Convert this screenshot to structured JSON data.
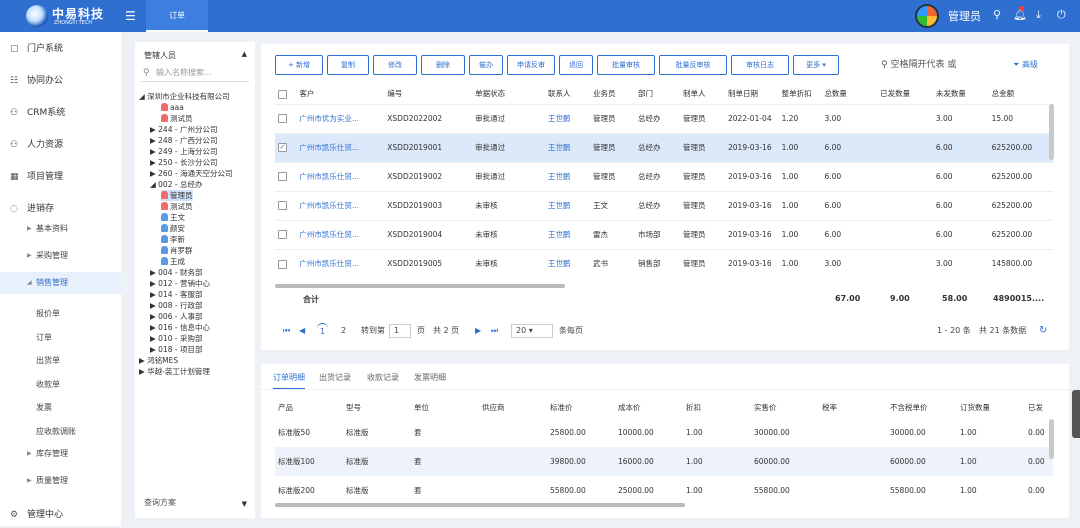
{
  "app": {
    "brand": "中易科技",
    "brand_sub": "ZHONGYI TECH",
    "top_tab": "订单",
    "user": "管理员"
  },
  "nav": {
    "items": [
      {
        "label": "门户系统",
        "icon": "portal-icon"
      },
      {
        "label": "协同办公",
        "icon": "office-icon"
      },
      {
        "label": "CRM系统",
        "icon": "crm-icon"
      },
      {
        "label": "人力资源",
        "icon": "hr-icon"
      },
      {
        "label": "项目管理",
        "icon": "project-icon"
      },
      {
        "label": "进销存",
        "icon": "inventory-icon"
      }
    ],
    "subs": [
      {
        "label": "基本资料"
      },
      {
        "label": "采购管理"
      },
      {
        "label": "销售管理"
      }
    ],
    "sales_leaves": [
      "报价单",
      "订单",
      "出货单",
      "收款单",
      "发票",
      "应收款调账"
    ],
    "subs2": [
      {
        "label": "库存管理"
      },
      {
        "label": "质量管理"
      }
    ],
    "bottom": {
      "label": "管理中心",
      "icon": "manage-icon"
    }
  },
  "tree": {
    "title": "管辖人员",
    "search_placeholder": "输入名称搜索...",
    "footer": "查询方案",
    "nodes": [
      {
        "t": "◢ 深圳市企业科技有限公司",
        "i": 0
      },
      {
        "t": "aaa",
        "i": 2,
        "p": "red"
      },
      {
        "t": "测试员",
        "i": 2,
        "p": "red"
      },
      {
        "t": "▶ 244 - 广州分公司",
        "i": 1
      },
      {
        "t": "▶ 248 - 广西分公司",
        "i": 1
      },
      {
        "t": "▶ 249 - 上海分公司",
        "i": 1
      },
      {
        "t": "▶ 250 - 长沙分公司",
        "i": 1
      },
      {
        "t": "▶ 260 - 海通天空分公司",
        "i": 1
      },
      {
        "t": "◢ 002 - 总经办",
        "i": 1
      },
      {
        "t": "管理员",
        "i": 2,
        "p": "red",
        "sel": true
      },
      {
        "t": "测试员",
        "i": 2,
        "p": "red"
      },
      {
        "t": "王文",
        "i": 2,
        "p": "blue"
      },
      {
        "t": "颜安",
        "i": 2,
        "p": "blue"
      },
      {
        "t": "李新",
        "i": 2,
        "p": "blue"
      },
      {
        "t": "肖罗群",
        "i": 2,
        "p": "blue"
      },
      {
        "t": "王成",
        "i": 2,
        "p": "blue"
      },
      {
        "t": "▶ 004 - 财务部",
        "i": 1
      },
      {
        "t": "▶ 012 - 营销中心",
        "i": 1
      },
      {
        "t": "▶ 014 - 客服部",
        "i": 1
      },
      {
        "t": "▶ 008 - 行政部",
        "i": 1
      },
      {
        "t": "▶ 006 - 人事部",
        "i": 1
      },
      {
        "t": "▶ 016 - 信息中心",
        "i": 1
      },
      {
        "t": "▶ 010 - 采购部",
        "i": 1
      },
      {
        "t": "▶ 018 - 项目部",
        "i": 1
      },
      {
        "t": "▶ 鸿铭MES",
        "i": 0
      },
      {
        "t": "▶ 华越-装工计划管理",
        "i": 0
      }
    ]
  },
  "toolbar": {
    "buttons": [
      "+ 新增",
      "复制",
      "修改",
      "删除",
      "催办",
      "申请反审",
      "退回",
      "批量审核",
      "批量反审核",
      "审核日志",
      "更多 ▾"
    ],
    "search_placeholder": "空格隔开代表 或",
    "advanced": "高级"
  },
  "orders": {
    "columns": [
      "客户",
      "编号",
      "单据状态",
      "联系人",
      "业务员",
      "部门",
      "制单人",
      "制单日期",
      "整单折扣",
      "总数量",
      "已发数量",
      "未发数量",
      "总金额"
    ],
    "rows": [
      {
        "checked": false,
        "cells": [
          "广州市优为实业...",
          "XSDD2022002",
          "审批通过",
          "王世鹏",
          "管理员",
          "总经办",
          "管理员",
          "2022-01-04",
          "1.20",
          "3.00",
          "",
          "3.00",
          "15.00"
        ]
      },
      {
        "checked": true,
        "cells": [
          "广州市凯乐仕贸...",
          "XSDD2019001",
          "审批通过",
          "王世鹏",
          "管理员",
          "总经办",
          "管理员",
          "2019-03-16",
          "1.00",
          "6.00",
          "",
          "6.00",
          "625200.00"
        ]
      },
      {
        "checked": false,
        "cells": [
          "广州市凯乐仕贸...",
          "XSDD2019002",
          "审批通过",
          "王世鹏",
          "管理员",
          "总经办",
          "管理员",
          "2019-03-16",
          "1.00",
          "6.00",
          "",
          "6.00",
          "625200.00"
        ]
      },
      {
        "checked": false,
        "cells": [
          "广州市凯乐仕贸...",
          "XSDD2019003",
          "未审核",
          "王世鹏",
          "王文",
          "总经办",
          "管理员",
          "2019-03-16",
          "1.00",
          "6.00",
          "",
          "6.00",
          "625200.00"
        ]
      },
      {
        "checked": false,
        "cells": [
          "广州市凯乐仕贸...",
          "XSDD2019004",
          "未审核",
          "王世鹏",
          "雷杰",
          "市场部",
          "管理员",
          "2019-03-16",
          "1.00",
          "6.00",
          "",
          "6.00",
          "625200.00"
        ]
      },
      {
        "checked": false,
        "cells": [
          "广州市凯乐仕贸...",
          "XSDD2019005",
          "未审核",
          "王世鹏",
          "武书",
          "销售部",
          "管理员",
          "2019-03-16",
          "1.00",
          "3.00",
          "",
          "3.00",
          "145800.00"
        ]
      }
    ],
    "summary": {
      "label": "合计",
      "total_qty": "67.00",
      "shipped": "9.00",
      "unshipped": "58.00",
      "amount": "4890015...."
    }
  },
  "pager": {
    "page1": "1",
    "page2": "2",
    "goto_label": "转到第",
    "goto_value": "1",
    "page_unit": "页",
    "total_pages": "共 2 页",
    "page_size": "20",
    "per_page": "条每页",
    "range": "1 - 20 条",
    "total": "共 21 条数据"
  },
  "detail": {
    "tabs": [
      "订单明细",
      "出货记录",
      "收款记录",
      "发票明细"
    ],
    "columns": [
      "产品",
      "型号",
      "单位",
      "供应商",
      "标准价",
      "成本价",
      "折扣",
      "实售价",
      "税率",
      "不含税单价",
      "订货数量",
      "已发"
    ],
    "rows": [
      [
        "标准版50",
        "标准版",
        "套",
        "",
        "25800.00",
        "10000.00",
        "1.00",
        "30000.00",
        "",
        "30000.00",
        "1.00",
        "0.00"
      ],
      [
        "标准版100",
        "标准版",
        "套",
        "",
        "39800.00",
        "16000.00",
        "1.00",
        "60000.00",
        "",
        "60000.00",
        "1.00",
        "0.00"
      ],
      [
        "标准版200",
        "标准版",
        "套",
        "",
        "55800.00",
        "25000.00",
        "1.00",
        "55800.00",
        "",
        "55800.00",
        "1.00",
        "0.00"
      ]
    ]
  }
}
